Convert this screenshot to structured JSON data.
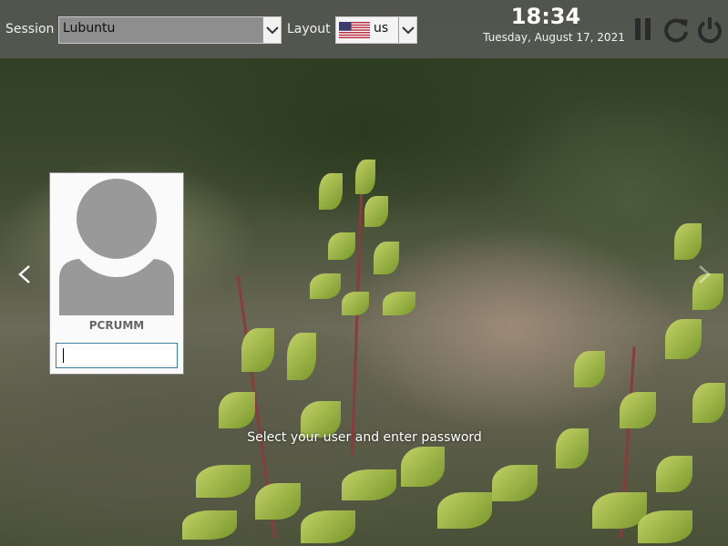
{
  "session": {
    "label": "Session",
    "value": "Lubuntu"
  },
  "layout": {
    "label": "Layout",
    "value": "us",
    "flag_icon": "us-flag-icon"
  },
  "clock": {
    "time": "18:34",
    "date": "Tuesday, August 17, 2021"
  },
  "power": {
    "icons": [
      "suspend-icon",
      "restart-icon",
      "shutdown-icon"
    ]
  },
  "user": {
    "name": "PCRUMM",
    "password_value": ""
  },
  "nav": {
    "prev_icon": "chevron-left-icon",
    "next_icon": "chevron-right-icon"
  },
  "hint": "Select your user and enter password",
  "colors": {
    "panel": "#5f5f5f",
    "accent": "#3a7fa0",
    "text": "#ffffff"
  }
}
